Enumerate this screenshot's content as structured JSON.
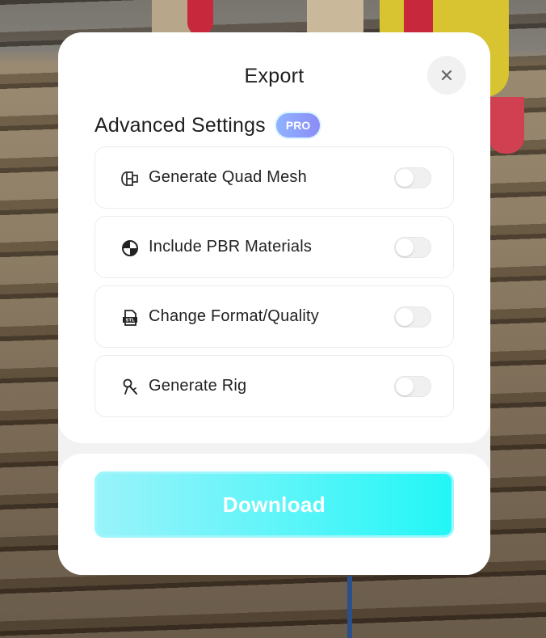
{
  "modal": {
    "title": "Export",
    "close_icon": "close-icon"
  },
  "advanced": {
    "title": "Advanced Settings",
    "badge": "PRO",
    "options": [
      {
        "label": "Generate Quad Mesh",
        "icon": "quad-mesh-icon",
        "enabled": false
      },
      {
        "label": "Include PBR Materials",
        "icon": "pbr-material-icon",
        "enabled": false
      },
      {
        "label": "Change Format/Quality",
        "icon": "stl-file-icon",
        "enabled": false
      },
      {
        "label": "Generate Rig",
        "icon": "rig-icon",
        "enabled": false
      }
    ]
  },
  "footer": {
    "download_label": "Download"
  },
  "colors": {
    "download_gradient_start": "#99f3fa",
    "download_gradient_end": "#22f6f6",
    "pro_badge_start": "#8fb3ff",
    "pro_badge_end": "#8b8cf6"
  }
}
